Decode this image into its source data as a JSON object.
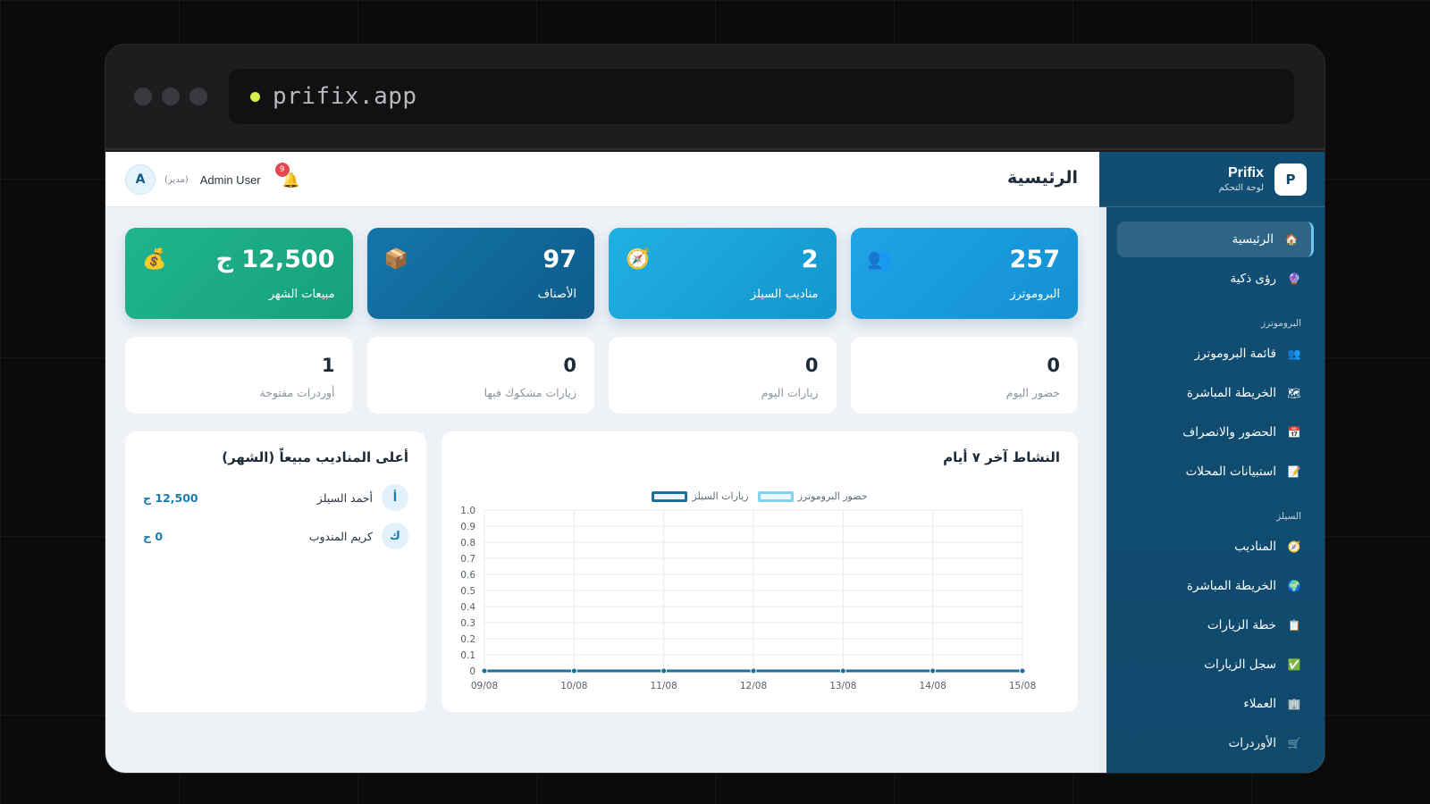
{
  "browser": {
    "url": "prifix.app"
  },
  "sidebar": {
    "brand_name": "Prifix",
    "brand_subtitle": "لوحة التحكم",
    "logo_letter": "P",
    "items_top": [
      {
        "label": "الرئيسية",
        "icon": "home-icon",
        "glyph": "🏠",
        "active": true
      },
      {
        "label": "رؤى ذكية",
        "icon": "insights-icon",
        "glyph": "🔮",
        "active": false
      }
    ],
    "section_promoters": "البروموترز",
    "items_promoters": [
      {
        "label": "قائمة البروموترز",
        "icon": "people-icon",
        "glyph": "👥"
      },
      {
        "label": "الخريطة المباشرة",
        "icon": "map-icon",
        "glyph": "🗺"
      },
      {
        "label": "الحضور والانصراف",
        "icon": "calendar-icon",
        "glyph": "📅"
      },
      {
        "label": "استبيانات المحلات",
        "icon": "survey-icon",
        "glyph": "📝"
      }
    ],
    "section_sales": "السيلز",
    "items_sales": [
      {
        "label": "المناديب",
        "icon": "compass-icon",
        "glyph": "🧭"
      },
      {
        "label": "الخريطة المباشرة",
        "icon": "globe-icon",
        "glyph": "🌍"
      },
      {
        "label": "خطة الزيارات",
        "icon": "plan-icon",
        "glyph": "📋"
      },
      {
        "label": "سجل الزيارات",
        "icon": "check-icon",
        "glyph": "✅"
      },
      {
        "label": "العملاء",
        "icon": "building-icon",
        "glyph": "🏢"
      },
      {
        "label": "الأوردرات",
        "icon": "cart-icon",
        "glyph": "🛒"
      }
    ]
  },
  "topbar": {
    "title": "الرئيسية",
    "user_name": "Admin User",
    "user_role": "(مدير)",
    "avatar_letter": "A",
    "notifications_count": "9"
  },
  "stats": [
    {
      "label": "البروموترز",
      "value": "257",
      "icon": "people-icon",
      "glyph": "👥",
      "color": "blue1"
    },
    {
      "label": "مناديب السيلز",
      "value": "2",
      "icon": "compass-icon",
      "glyph": "🧭",
      "color": "blue2"
    },
    {
      "label": "الأصناف",
      "value": "97",
      "icon": "box-icon",
      "glyph": "📦",
      "color": "navy"
    },
    {
      "label": "مبيعات الشهر",
      "value": "12,500 ج",
      "icon": "money-bag-icon",
      "glyph": "💰",
      "color": "green"
    }
  ],
  "mini_stats": [
    {
      "label": "حضور اليوم",
      "value": "0"
    },
    {
      "label": "زيارات اليوم",
      "value": "0"
    },
    {
      "label": "زيارات مشكوك فيها",
      "value": "0"
    },
    {
      "label": "أوردرات مفتوحة",
      "value": "1"
    }
  ],
  "top_sellers": {
    "title": "أعلى المناديب مبيعاً (الشهر)",
    "rows": [
      {
        "initial": "أ",
        "name": "أحمد السيلز",
        "amount": "12,500 ج"
      },
      {
        "initial": "ك",
        "name": "كريم المندوب",
        "amount": "0 ج"
      }
    ]
  },
  "activity": {
    "title": "النشاط آخر ٧ أيام"
  },
  "chart_data": {
    "type": "line",
    "title": "النشاط آخر ٧ أيام",
    "x": [
      "09/08",
      "10/08",
      "11/08",
      "12/08",
      "13/08",
      "14/08",
      "15/08"
    ],
    "series": [
      {
        "name": "حضور البروموترز",
        "values": [
          0,
          0,
          0,
          0,
          0,
          0,
          0
        ],
        "color": "#7fd3ef"
      },
      {
        "name": "زيارات السيلز",
        "values": [
          0,
          0,
          0,
          0,
          0,
          0,
          0
        ],
        "color": "#1a6f9c"
      }
    ],
    "ylim": [
      0,
      1.0
    ],
    "yticks": [
      "0",
      "0.1",
      "0.2",
      "0.3",
      "0.4",
      "0.5",
      "0.6",
      "0.7",
      "0.8",
      "0.9",
      "1.0"
    ],
    "grid": true,
    "legend": "top-center"
  }
}
